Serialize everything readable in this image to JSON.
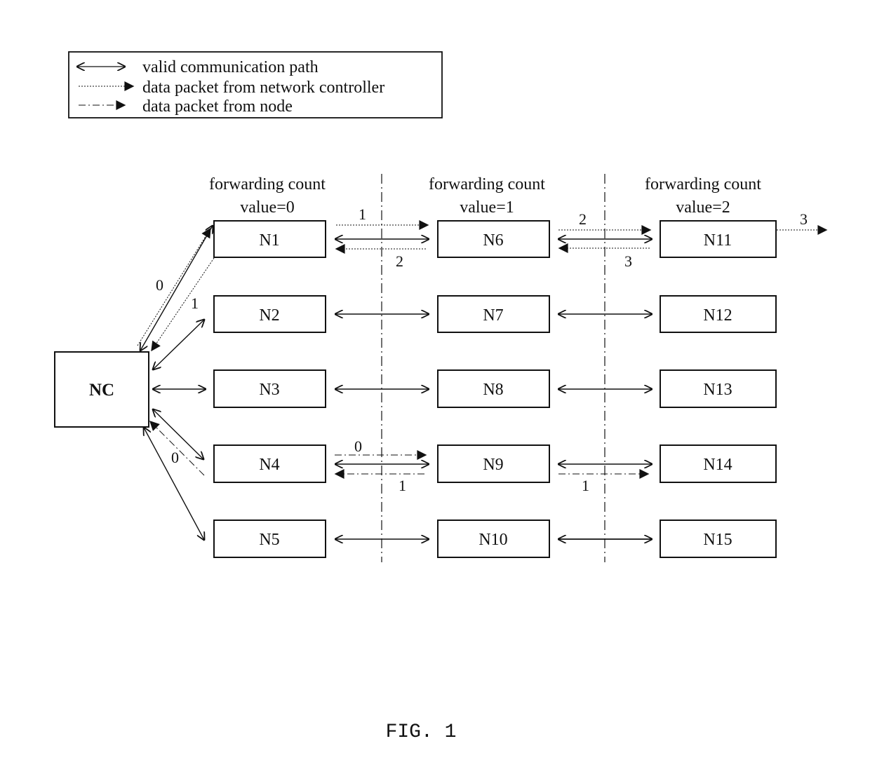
{
  "legend": {
    "items": [
      {
        "style": "solid-double",
        "label": "valid communication path"
      },
      {
        "style": "dotted",
        "label": "data packet from network controller"
      },
      {
        "style": "dashdot",
        "label": "data packet from node"
      }
    ]
  },
  "columns": [
    {
      "line1": "forwarding count",
      "line2": "value=0"
    },
    {
      "line1": "forwarding count",
      "line2": "value=1"
    },
    {
      "line1": "forwarding count",
      "line2": "value=2"
    }
  ],
  "controller": {
    "label": "NC"
  },
  "nodes": [
    [
      "N1",
      "N6",
      "N11"
    ],
    [
      "N2",
      "N7",
      "N12"
    ],
    [
      "N3",
      "N8",
      "N13"
    ],
    [
      "N4",
      "N9",
      "N14"
    ],
    [
      "N5",
      "N10",
      "N15"
    ]
  ],
  "step_labels": {
    "nc_n1_dotted_out": "0",
    "nc_n1_dotted_back": "1",
    "n1_n6_dotted_out": "1",
    "n1_n6_dotted_back": "2",
    "n6_n11_dotted_out": "2",
    "n6_n11_dotted_back": "3",
    "n11_out": "3",
    "n4_nc_dashdot": "0",
    "n4_n9_dashdot_out": "0",
    "n4_n9_dashdot_back": "1",
    "n9_n14_dashdot": "1"
  },
  "caption": "FIG. 1"
}
